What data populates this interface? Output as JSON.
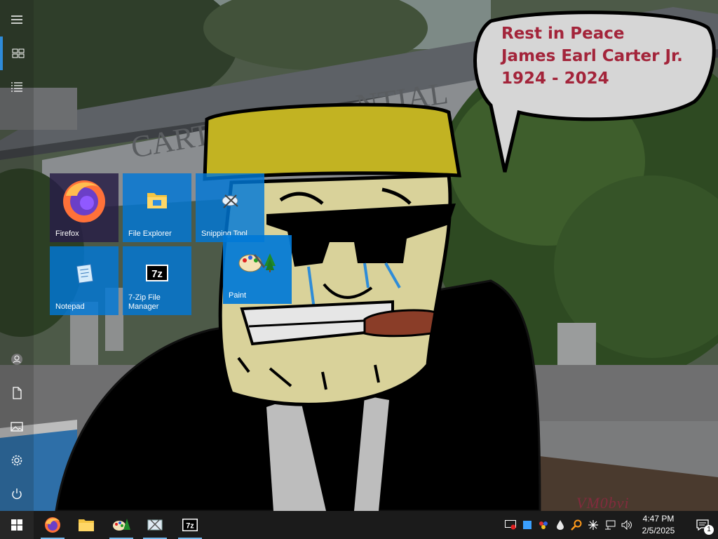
{
  "desktop": {
    "bubble": {
      "line1": "Rest in Peace",
      "line2": "James Earl Carter Jr.",
      "line3": "1924 - 2024"
    },
    "building_sign": "CARTER PRESIDENTIAL",
    "watermark": "VM0bvi"
  },
  "start_menu": {
    "tiles": [
      {
        "label": "Firefox",
        "icon": "firefox-icon"
      },
      {
        "label": "File Explorer",
        "icon": "folder-icon"
      },
      {
        "label": "Snipping Tool",
        "icon": "scissors-icon"
      },
      {
        "label": "Notepad",
        "icon": "notepad-icon"
      },
      {
        "label": "7-Zip File Manager",
        "icon": "7zip-icon"
      },
      {
        "label": "Paint",
        "icon": "paint-icon"
      }
    ]
  },
  "taskbar": {
    "apps": [
      {
        "name": "Firefox",
        "icon": "firefox-icon",
        "running": true
      },
      {
        "name": "File Explorer",
        "icon": "folder-icon",
        "running": false
      },
      {
        "name": "Paint",
        "icon": "paint-icon",
        "running": true
      },
      {
        "name": "Snipping Tool",
        "icon": "scissors-icon",
        "running": true
      },
      {
        "name": "7-Zip File Manager",
        "icon": "7zip-icon",
        "running": true
      }
    ],
    "clock": {
      "time": "4:47 PM",
      "date": "2/5/2025"
    },
    "notification_count": "1"
  },
  "colors": {
    "accent": "#0078d7",
    "taskbar": "#1b1b1b",
    "bubble_text": "#a3243a"
  }
}
